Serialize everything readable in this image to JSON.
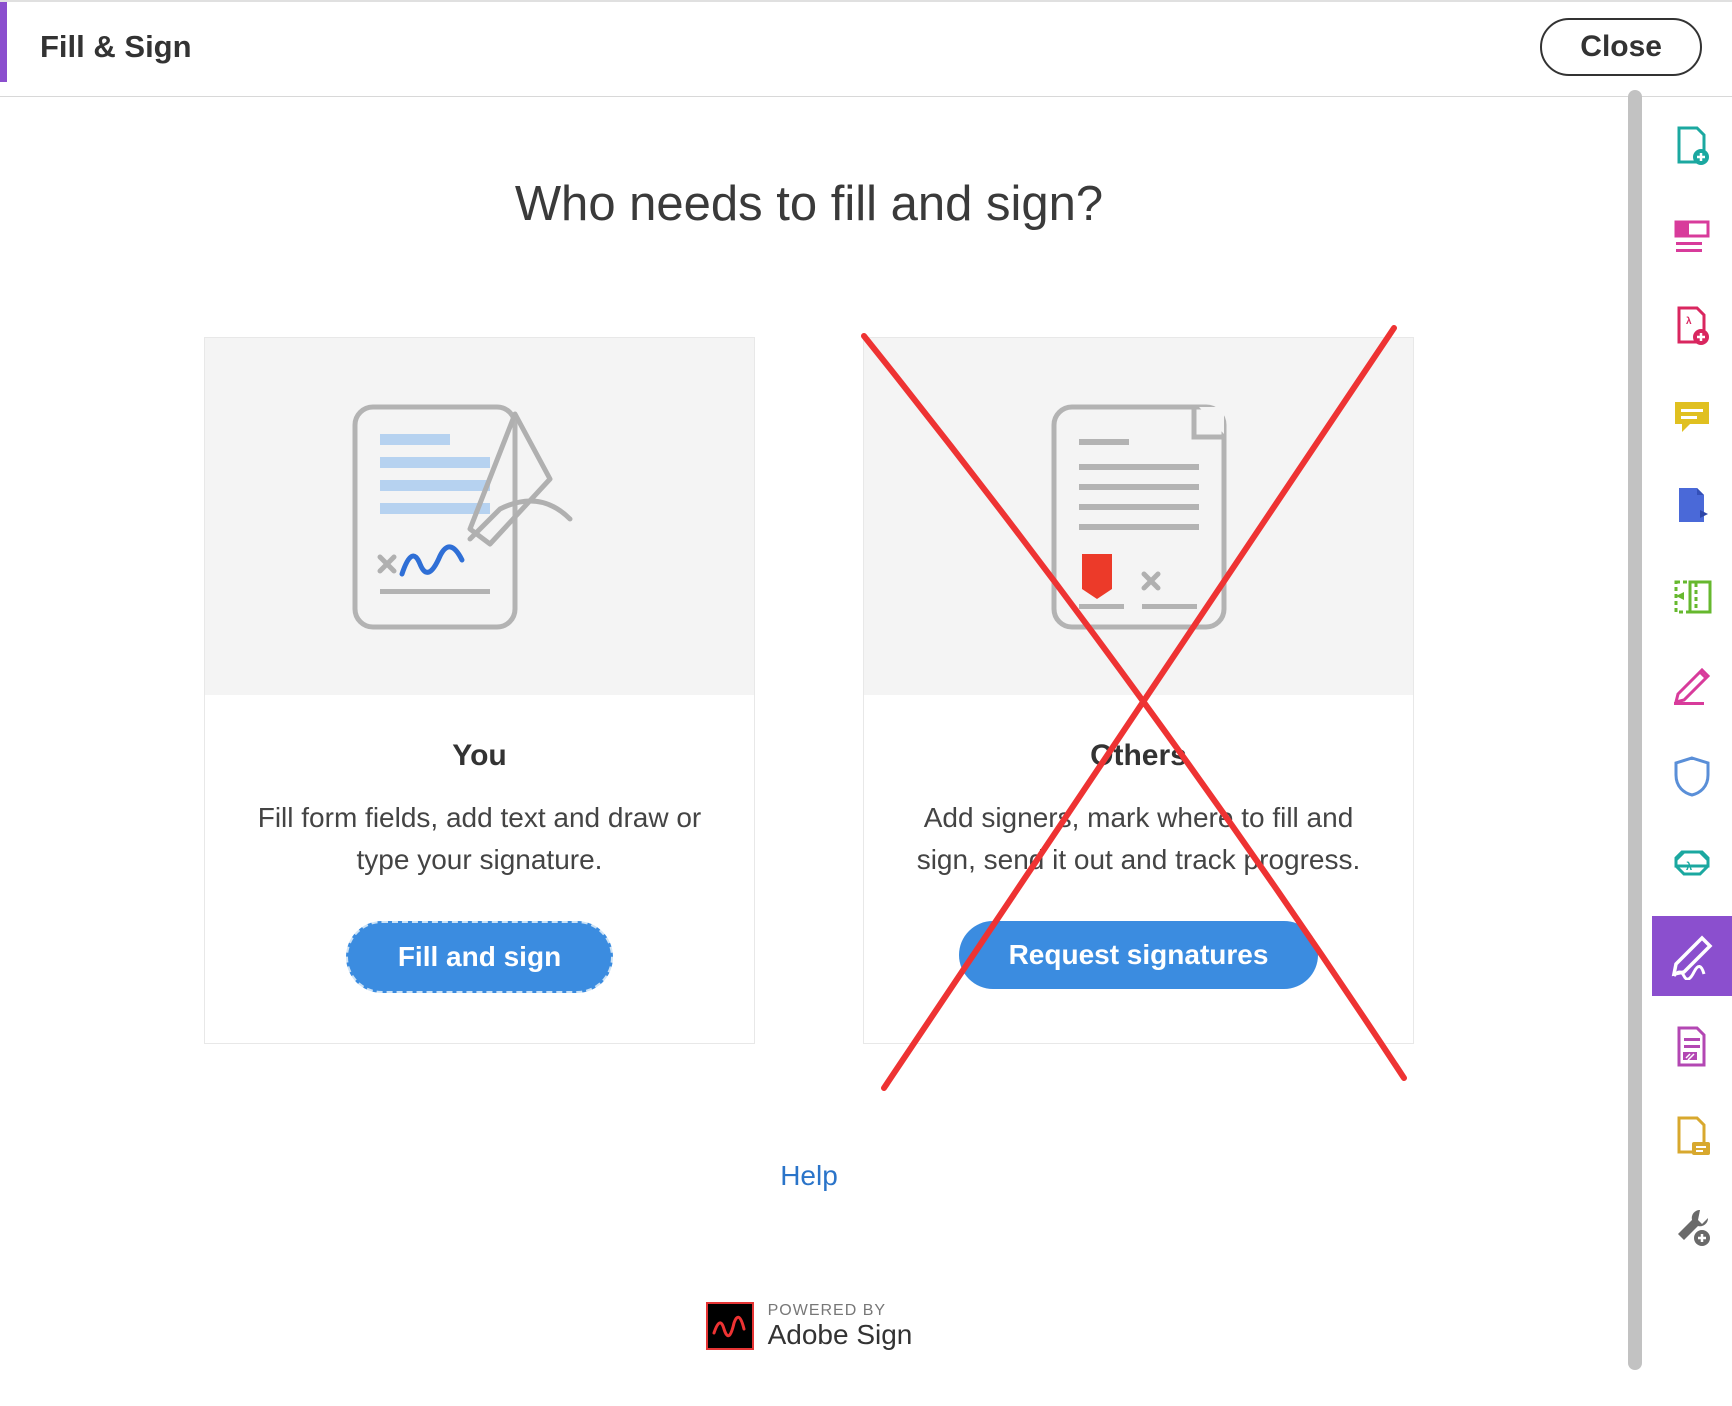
{
  "header": {
    "title": "Fill & Sign",
    "close_label": "Close"
  },
  "main": {
    "heading": "Who needs to fill and sign?",
    "cards": {
      "you": {
        "title": "You",
        "desc": "Fill form fields, add text and draw or type your signature.",
        "button": "Fill and sign"
      },
      "others": {
        "title": "Others",
        "desc": "Add signers, mark where to fill and sign, send it out and track progress.",
        "button": "Request signatures"
      }
    },
    "help_label": "Help",
    "powered_by": "POWERED BY",
    "powered_name": "Adobe Sign"
  },
  "rail": {
    "items": [
      "export-pdf-icon",
      "organize-pages-icon",
      "create-pdf-icon",
      "comment-icon",
      "edit-pdf-icon",
      "compare-icon",
      "sign-icon",
      "protect-icon",
      "optimize-icon",
      "fill-sign-icon",
      "redact-icon",
      "send-review-icon",
      "more-tools-icon"
    ]
  }
}
